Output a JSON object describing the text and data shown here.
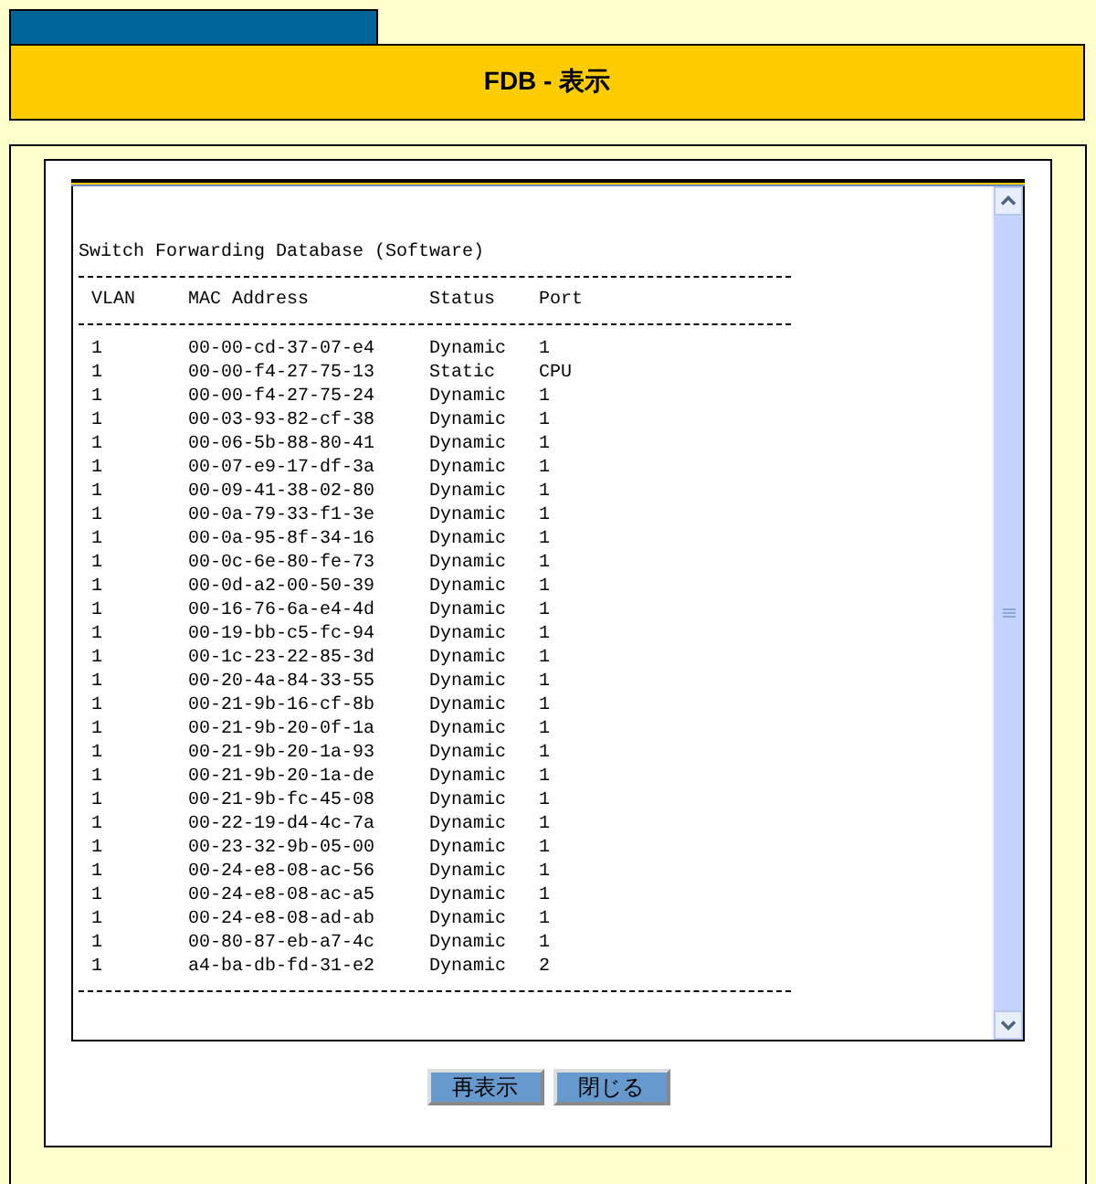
{
  "header": {
    "title": "FDB - 表示"
  },
  "listing": {
    "title": "Switch Forwarding Database (Software)",
    "columns": [
      "VLAN",
      "MAC Address",
      "Status",
      "Port"
    ],
    "rows": [
      {
        "vlan": "1",
        "mac": "00-00-cd-37-07-e4",
        "status": "Dynamic",
        "port": "1"
      },
      {
        "vlan": "1",
        "mac": "00-00-f4-27-75-13",
        "status": "Static",
        "port": "CPU"
      },
      {
        "vlan": "1",
        "mac": "00-00-f4-27-75-24",
        "status": "Dynamic",
        "port": "1"
      },
      {
        "vlan": "1",
        "mac": "00-03-93-82-cf-38",
        "status": "Dynamic",
        "port": "1"
      },
      {
        "vlan": "1",
        "mac": "00-06-5b-88-80-41",
        "status": "Dynamic",
        "port": "1"
      },
      {
        "vlan": "1",
        "mac": "00-07-e9-17-df-3a",
        "status": "Dynamic",
        "port": "1"
      },
      {
        "vlan": "1",
        "mac": "00-09-41-38-02-80",
        "status": "Dynamic",
        "port": "1"
      },
      {
        "vlan": "1",
        "mac": "00-0a-79-33-f1-3e",
        "status": "Dynamic",
        "port": "1"
      },
      {
        "vlan": "1",
        "mac": "00-0a-95-8f-34-16",
        "status": "Dynamic",
        "port": "1"
      },
      {
        "vlan": "1",
        "mac": "00-0c-6e-80-fe-73",
        "status": "Dynamic",
        "port": "1"
      },
      {
        "vlan": "1",
        "mac": "00-0d-a2-00-50-39",
        "status": "Dynamic",
        "port": "1"
      },
      {
        "vlan": "1",
        "mac": "00-16-76-6a-e4-4d",
        "status": "Dynamic",
        "port": "1"
      },
      {
        "vlan": "1",
        "mac": "00-19-bb-c5-fc-94",
        "status": "Dynamic",
        "port": "1"
      },
      {
        "vlan": "1",
        "mac": "00-1c-23-22-85-3d",
        "status": "Dynamic",
        "port": "1"
      },
      {
        "vlan": "1",
        "mac": "00-20-4a-84-33-55",
        "status": "Dynamic",
        "port": "1"
      },
      {
        "vlan": "1",
        "mac": "00-21-9b-16-cf-8b",
        "status": "Dynamic",
        "port": "1"
      },
      {
        "vlan": "1",
        "mac": "00-21-9b-20-0f-1a",
        "status": "Dynamic",
        "port": "1"
      },
      {
        "vlan": "1",
        "mac": "00-21-9b-20-1a-93",
        "status": "Dynamic",
        "port": "1"
      },
      {
        "vlan": "1",
        "mac": "00-21-9b-20-1a-de",
        "status": "Dynamic",
        "port": "1"
      },
      {
        "vlan": "1",
        "mac": "00-21-9b-fc-45-08",
        "status": "Dynamic",
        "port": "1"
      },
      {
        "vlan": "1",
        "mac": "00-22-19-d4-4c-7a",
        "status": "Dynamic",
        "port": "1"
      },
      {
        "vlan": "1",
        "mac": "00-23-32-9b-05-00",
        "status": "Dynamic",
        "port": "1"
      },
      {
        "vlan": "1",
        "mac": "00-24-e8-08-ac-56",
        "status": "Dynamic",
        "port": "1"
      },
      {
        "vlan": "1",
        "mac": "00-24-e8-08-ac-a5",
        "status": "Dynamic",
        "port": "1"
      },
      {
        "vlan": "1",
        "mac": "00-24-e8-08-ad-ab",
        "status": "Dynamic",
        "port": "1"
      },
      {
        "vlan": "1",
        "mac": "00-80-87-eb-a7-4c",
        "status": "Dynamic",
        "port": "1"
      },
      {
        "vlan": "1",
        "mac": "a4-ba-db-fd-31-e2",
        "status": "Dynamic",
        "port": "2"
      }
    ]
  },
  "buttons": [
    "再表示",
    "閉じる"
  ]
}
